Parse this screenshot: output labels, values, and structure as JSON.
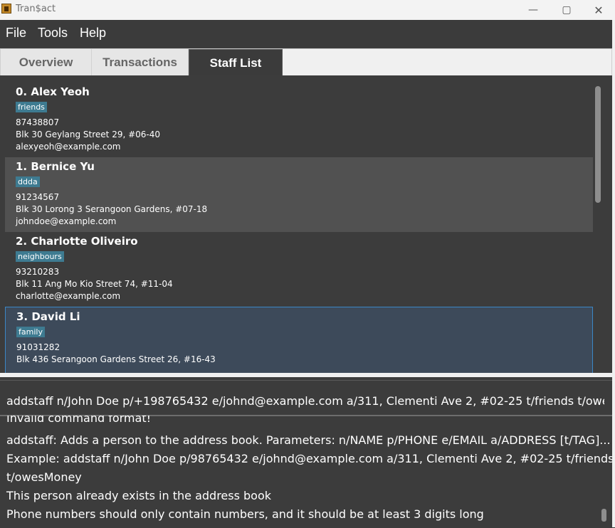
{
  "window": {
    "title": "Tran$act",
    "minimize_icon": "minimize-icon",
    "maximize_icon": "maximize-icon",
    "close_icon": "close-icon"
  },
  "menu": {
    "items": [
      {
        "label": "File"
      },
      {
        "label": "Tools"
      },
      {
        "label": "Help"
      }
    ]
  },
  "tabs": [
    {
      "label": "Overview",
      "active": false
    },
    {
      "label": "Transactions",
      "active": false
    },
    {
      "label": "Staff List",
      "active": true
    }
  ],
  "staff": [
    {
      "name": "0.  Alex Yeoh",
      "tag": "friends",
      "phone": "87438807",
      "address": "Blk 30 Geylang Street 29, #06-40",
      "email": "alexyeoh@example.com"
    },
    {
      "name": "1.  Bernice Yu",
      "tag": "ddda",
      "phone": "91234567",
      "address": "Blk 30 Lorong 3 Serangoon Gardens, #07-18",
      "email": "johndoe@example.com"
    },
    {
      "name": "2.  Charlotte Oliveiro",
      "tag": "neighbours",
      "phone": "93210283",
      "address": "Blk 11 Ang Mo Kio Street 74, #11-04",
      "email": "charlotte@example.com"
    },
    {
      "name": "3.  David Li",
      "tag": "family",
      "phone": "91031282",
      "address": "Blk 436 Serangoon Gardens Street 26, #16-43",
      "email": ""
    }
  ],
  "command": {
    "value": "addstaff n/John Doe p/+198765432 e/johnd@example.com a/311, Clementi Ave 2, #02-25 t/friends t/owesMoney"
  },
  "result": {
    "lines": [
      "Invalid command format!",
      "addstaff: Adds a person to the address book. Parameters: n/NAME p/PHONE e/EMAIL a/ADDRESS [t/TAG]...",
      "Example: addstaff n/John Doe p/98765432 e/johnd@example.com a/311, Clementi Ave 2, #02-25 t/friends",
      "t/owesMoney",
      "This person already exists in the address book",
      "Phone numbers should only contain numbers, and it should be at least 3 digits long"
    ]
  },
  "colors": {
    "tag_bg": "#3e7b91",
    "selected_border": "#3b87c6",
    "panel_bg": "#3c3c3c"
  }
}
